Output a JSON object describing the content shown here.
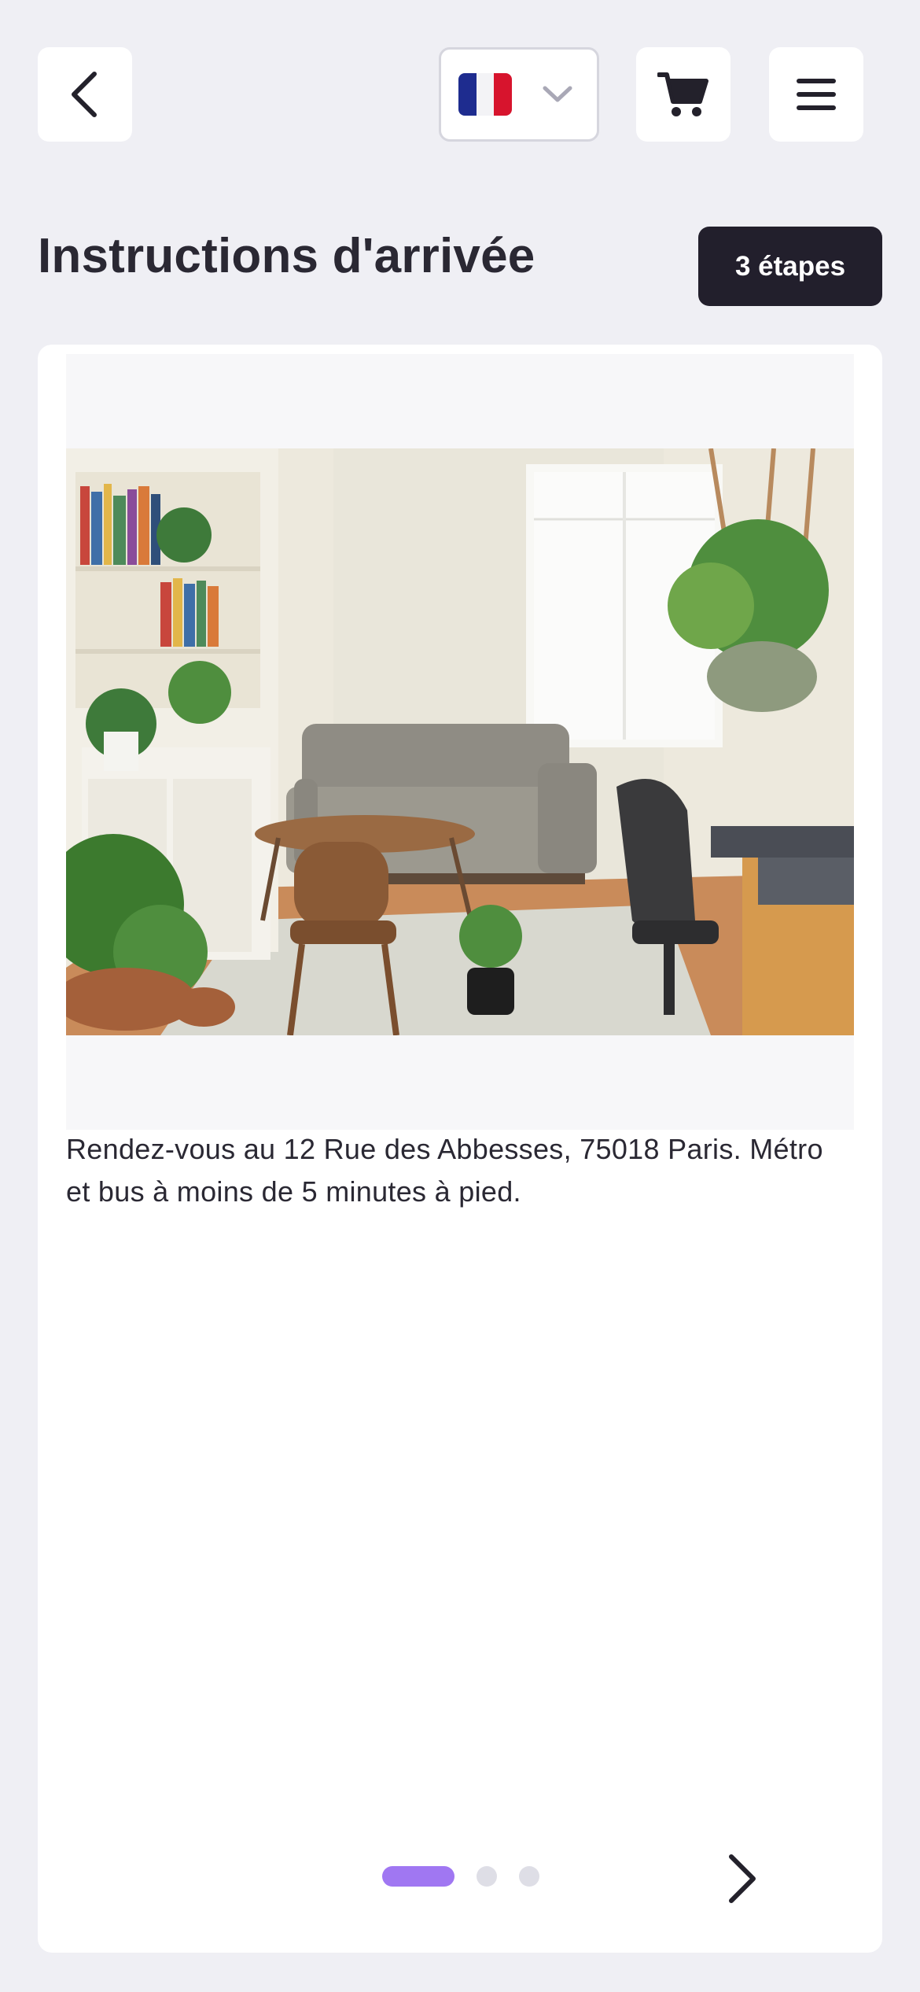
{
  "header": {
    "title": "Instructions d'arrivée",
    "steps_badge": "3 étapes"
  },
  "topbar": {
    "back_icon": "chevron-left-icon",
    "language": {
      "selected": "fr",
      "flag_icon": "france-flag-icon",
      "chevron_icon": "chevron-down-icon"
    },
    "cart_icon": "shopping-cart-icon",
    "menu_icon": "hamburger-menu-icon"
  },
  "step": {
    "image_alt": "Salon lumineux avec canapé gris, plantes et bibliothèque",
    "text": "Rendez-vous au 12 Rue des Abbesses, 75018 Paris. Métro et bus à moins de 5 minutes à pied."
  },
  "pager": {
    "total": 3,
    "current": 1,
    "next_icon": "chevron-right-icon"
  },
  "colors": {
    "background": "#EFEFF4",
    "badge": "#221F2C",
    "accent": "#A077F2",
    "dot_inactive": "#DEDEE6"
  }
}
